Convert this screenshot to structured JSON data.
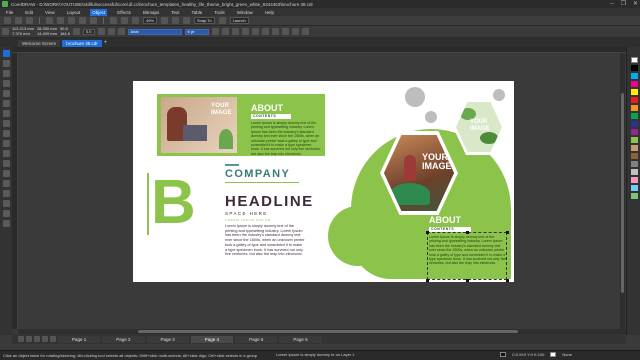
{
  "window": {
    "title": "CorelDRAW - D:\\WORK\\YOUTUBE\\skillfulsuccessful\\corel.dl.cc\\brochure_templates_healthy_life_theme_bright_green_white_8344463\\brochure 38.cdr",
    "controls": [
      "–",
      "❐",
      "✕"
    ]
  },
  "menu": {
    "items": [
      "File",
      "Edit",
      "View",
      "Layout",
      "Object",
      "Effects",
      "Bitmaps",
      "Text",
      "Table",
      "Tools",
      "Window",
      "Help"
    ],
    "active": "Object"
  },
  "toolbar": {
    "zoom": "49%",
    "snap_to": "Snap To",
    "launch": "Launch"
  },
  "properties": {
    "x": "113.213 mm",
    "y": "7.376 mm",
    "w": "28.350 mm",
    "h": "14.409 mm",
    "scale_w": "90.6",
    "scale_h": "164.6",
    "rotation": "0.0",
    "font": "Arial",
    "font_size": "6 pt"
  },
  "tabs": {
    "welcome": "Welcome Screen",
    "document": "brochure 38.cdr",
    "add": "+"
  },
  "page": {
    "about1": {
      "title": "ABOUT",
      "contents": "CONTENTS",
      "body": "Lorem Ipsum is simply dummy text of the printing and typesetting industry. Lorem Ipsum has been the industry's standard dummy text ever since the 1500s, when an unknown printer took a galley of type and scrambled it to make a type specimen book. It has survived not only five centuries, but also the leap into electronic."
    },
    "image_label": "YOUR IMAGE",
    "big_letter": "B",
    "company": "COMPANY",
    "headline": "HEADLINE",
    "space_here": "SPACE HERE",
    "small_caps": "LOREM IPSUM DOLOR",
    "headline_body": "Lorem Ipsum is simply dummy text of the printing and typesetting industry. Lorem Ipsum has been the industry's standard dummy text ever since the 1500s, when an unknown printer took a galley of type and scrambled it to make a type specimen book. It has survived not only five centuries, but also the leap into electronic.",
    "about2": {
      "title": "ABOUT",
      "contents": "CONTENTS",
      "body": "Lorem Ipsum is simply dummy text of the printing and typesetting industry. Lorem Ipsum has been the industry's standard dummy text ever since the 1500s, when an unknown printer took a galley of type and scrambled it to make a type specimen book. It has survived not only five centuries, but also the leap into electronic."
    }
  },
  "pages": [
    "Page 1",
    "Page 2",
    "Page 3",
    "Page 4",
    "Page 5",
    "Page 6"
  ],
  "active_page": "Page 4",
  "status": {
    "hint": "Click an object twice for rotating/skewing; dbl-clicking tool selects all objects; Shift+click multi-selects; Alt+click digs; Ctrl+click selects in a group",
    "object": "Lorem Ipsum is simply dummy te on Layer 1",
    "color_model": "C:0 M:0 Y:0 K:100",
    "fill": "None"
  },
  "colors": {
    "brand_green": "#8cc44b",
    "teal": "#3a7a7a",
    "dark_text": "#3d2a3a",
    "accent_blue": "#1e6fd9"
  }
}
